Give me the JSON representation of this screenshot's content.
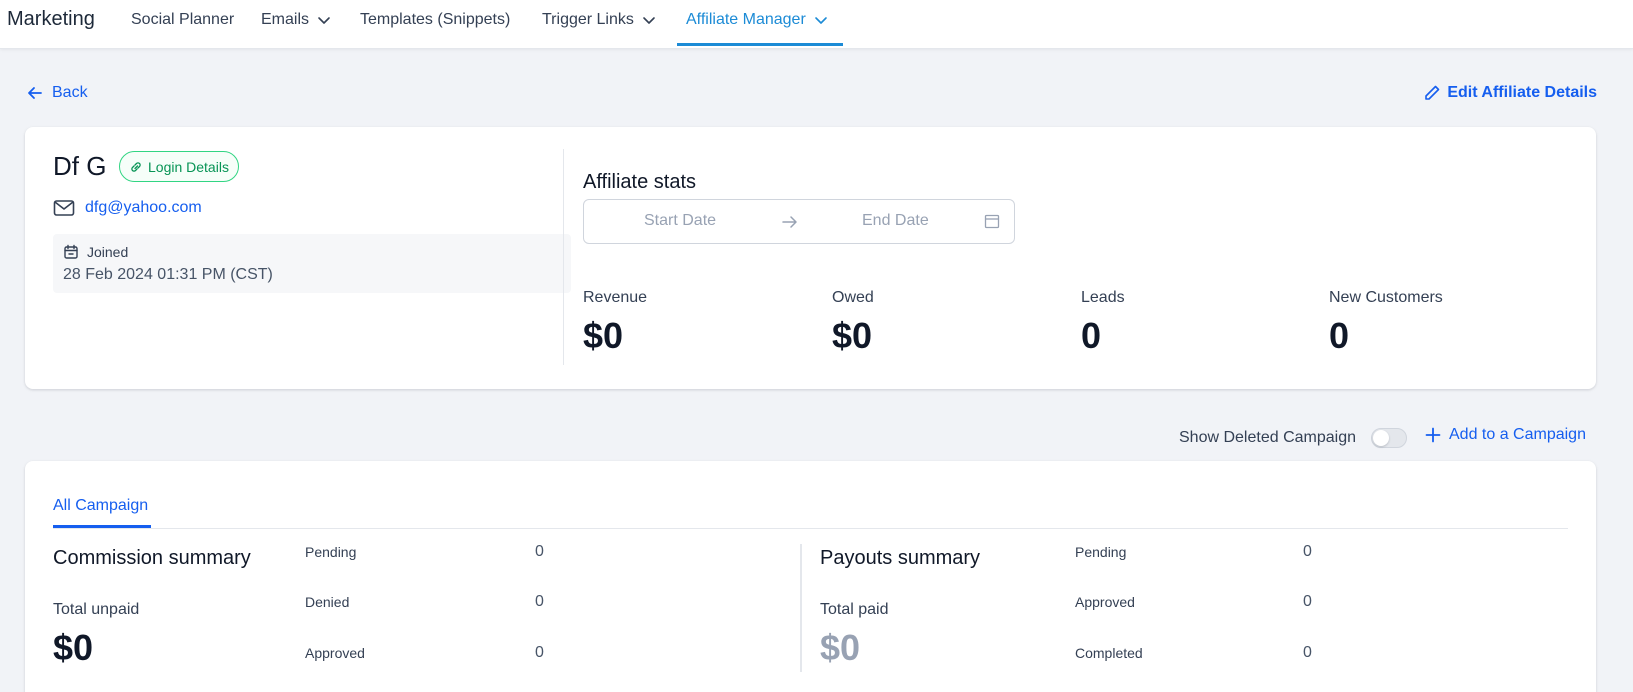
{
  "nav": {
    "brand": "Marketing",
    "items": [
      {
        "label": "Social Planner",
        "dropdown": false
      },
      {
        "label": "Emails",
        "dropdown": true
      },
      {
        "label": "Templates (Snippets)",
        "dropdown": false
      },
      {
        "label": "Trigger Links",
        "dropdown": true
      },
      {
        "label": "Affiliate Manager",
        "dropdown": true,
        "active": true
      }
    ]
  },
  "actions": {
    "back_label": "Back",
    "edit_label": "Edit Affiliate Details"
  },
  "affiliate": {
    "name": "Df G",
    "login_badge": "Login Details",
    "email": "dfg@yahoo.com",
    "joined_label": "Joined",
    "joined_date": "28 Feb 2024 01:31 PM (CST)"
  },
  "stats": {
    "title": "Affiliate stats",
    "start_placeholder": "Start Date",
    "end_placeholder": "End Date",
    "items": [
      {
        "label": "Revenue",
        "value": "$0"
      },
      {
        "label": "Owed",
        "value": "$0"
      },
      {
        "label": "Leads",
        "value": "0"
      },
      {
        "label": "New Customers",
        "value": "0"
      }
    ]
  },
  "campaign_controls": {
    "show_deleted_label": "Show Deleted Campaign",
    "show_deleted_on": false,
    "add_label": "Add to a Campaign"
  },
  "campaigns": {
    "tab": "All Campaign",
    "commission": {
      "title": "Commission summary",
      "total_label": "Total unpaid",
      "total_value": "$0",
      "rows": [
        {
          "label": "Pending",
          "value": "0"
        },
        {
          "label": "Denied",
          "value": "0"
        },
        {
          "label": "Approved",
          "value": "0"
        }
      ]
    },
    "payouts": {
      "title": "Payouts summary",
      "total_label": "Total paid",
      "total_value": "$0",
      "rows": [
        {
          "label": "Pending",
          "value": "0"
        },
        {
          "label": "Approved",
          "value": "0"
        },
        {
          "label": "Completed",
          "value": "0"
        }
      ]
    }
  },
  "colors": {
    "accent": "#155eef",
    "nav_active": "#1c8bd6",
    "badge_green": "#079455",
    "muted_value": "#98a2b3"
  }
}
